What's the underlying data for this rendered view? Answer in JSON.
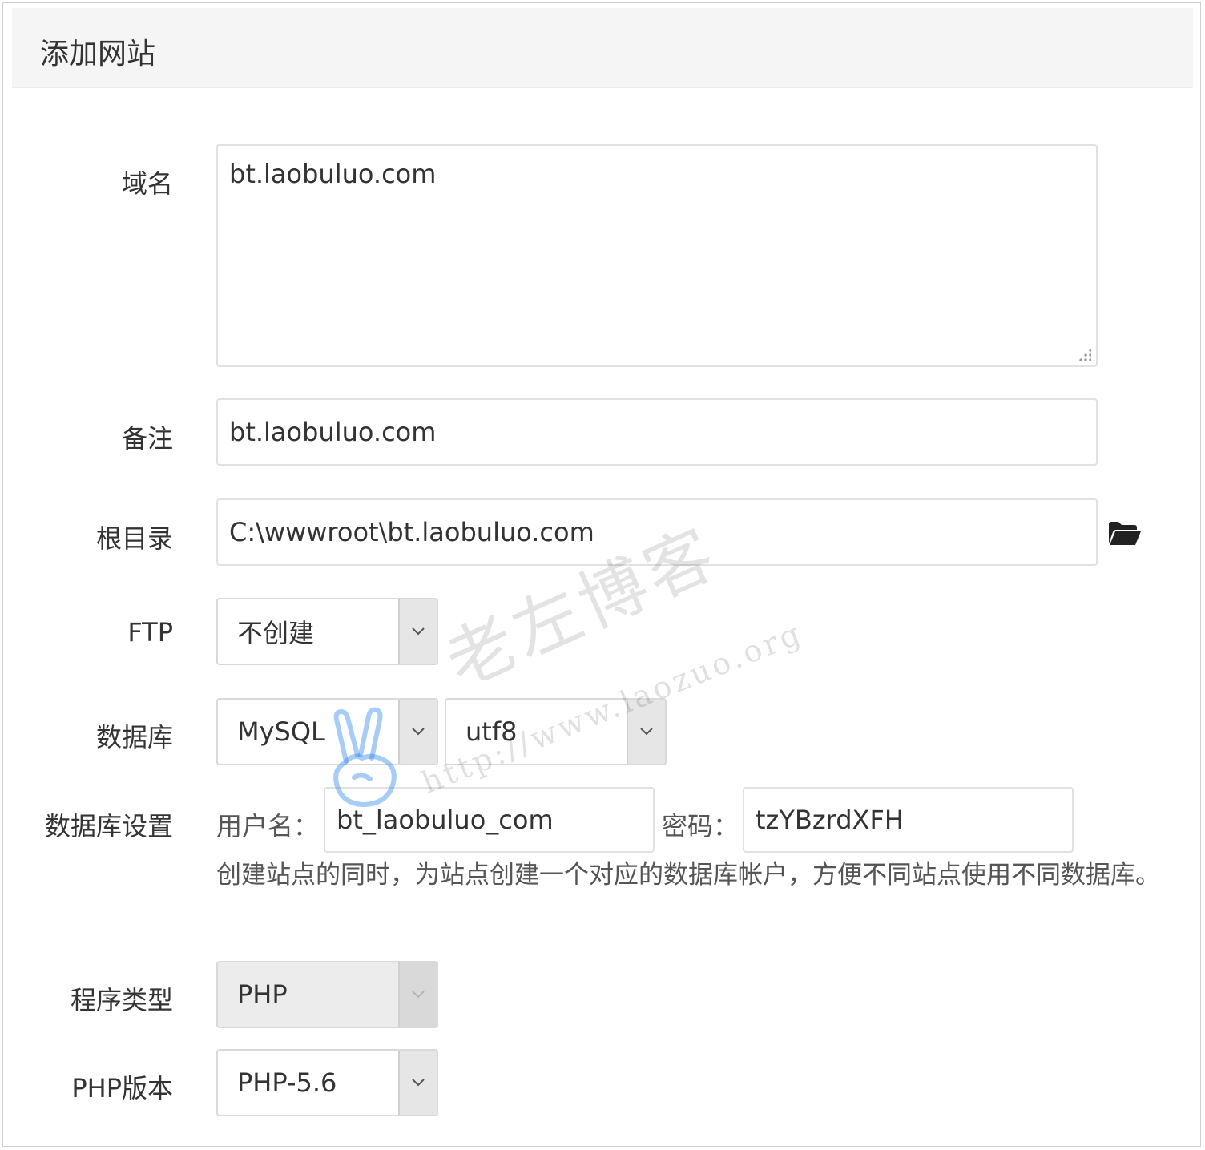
{
  "dialog": {
    "title": "添加网站"
  },
  "form": {
    "domain": {
      "label": "域名",
      "value": "bt.laobuluo.com"
    },
    "remark": {
      "label": "备注",
      "value": "bt.laobuluo.com"
    },
    "root_dir": {
      "label": "根目录",
      "value": "C:\\wwwroot\\bt.laobuluo.com",
      "icon": "folder-open-icon"
    },
    "ftp": {
      "label": "FTP",
      "selected": "不创建"
    },
    "database": {
      "label": "数据库",
      "type_selected": "MySQL",
      "charset_selected": "utf8"
    },
    "db_settings": {
      "label": "数据库设置",
      "username_label": "用户名：",
      "username_value": "bt_laobuluo_com",
      "password_label": "密码：",
      "password_value": "tzYBzrdXFH",
      "hint": "创建站点的同时，为站点创建一个对应的数据库帐户，方便不同站点使用不同数据库。"
    },
    "program_type": {
      "label": "程序类型",
      "selected": "PHP",
      "disabled": true
    },
    "php_version": {
      "label": "PHP版本",
      "selected": "PHP-5.6"
    }
  },
  "watermark": {
    "text": "老左博客",
    "url": "http://www.laozuo.org"
  },
  "colors": {
    "border": "#e1e1e1",
    "title_bg": "#f5f5f5",
    "arrow_bg": "#e6e6e6",
    "watermark_hand": "#3b8fe8"
  }
}
